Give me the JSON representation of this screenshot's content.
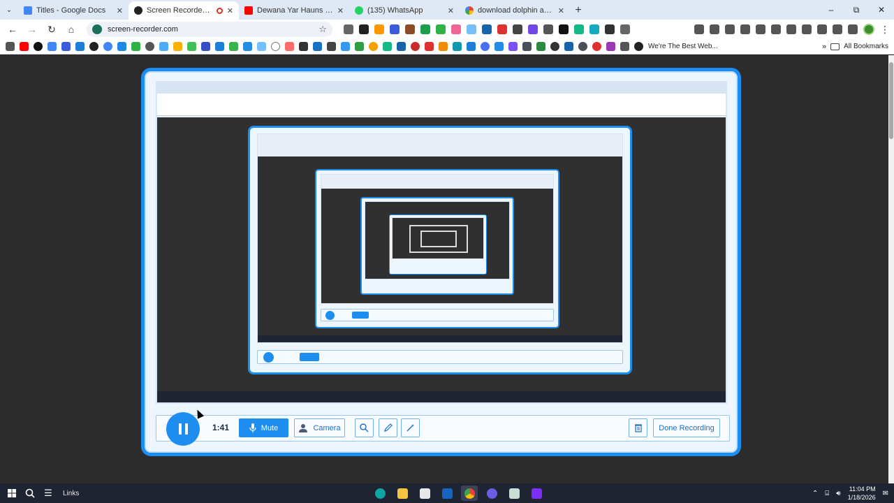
{
  "tabs": [
    {
      "title": "Titles - Google Docs",
      "color": "#4285f4",
      "active": false
    },
    {
      "title": "Screen Recorder | Free & Online",
      "color": "#222222",
      "active": true,
      "recording": true
    },
    {
      "title": "Dewana Yar Hauns - YouTube",
      "color": "#ff0000",
      "active": false
    },
    {
      "title": "(135) WhatsApp",
      "color": "#25d366",
      "active": false
    },
    {
      "title": "download dolphin anty - Google Search",
      "color": "#ffffff",
      "active": false
    }
  ],
  "omnibox": {
    "url": "screen-recorder.com"
  },
  "bookmarks": {
    "last_label": "We're The Best Web...",
    "all_label": "All Bookmarks"
  },
  "recorder": {
    "timer": "1:41",
    "mute_label": "Mute",
    "camera_label": "Camera",
    "done_label": "Done Recording"
  },
  "taskbar": {
    "links_label": "Links",
    "time": "11:04 PM",
    "date": "1/18/2026"
  }
}
